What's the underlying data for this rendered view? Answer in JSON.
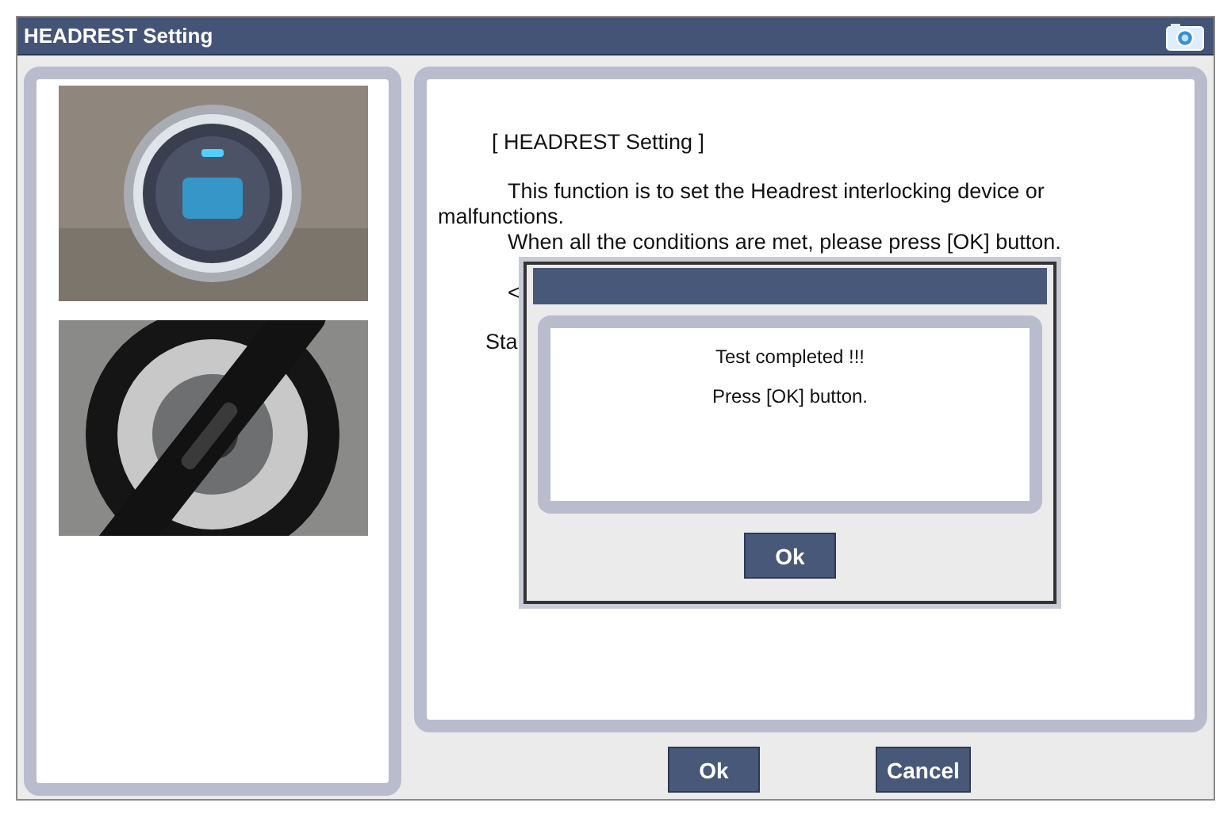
{
  "window": {
    "title": "HEADREST Setting"
  },
  "content": {
    "heading": "[ HEADREST Setting ]",
    "paragraphs": [
      "This function is to set the Headrest interlocking device or malfunctions.",
      "When all the conditions are met, please press [OK] button."
    ],
    "line_3": "<",
    "line_4": "Sta"
  },
  "dialog": {
    "messages": [
      "Test completed !!!",
      "Press [OK] button."
    ],
    "button": "Ok"
  },
  "buttons": [
    "Ok",
    "Cancel"
  ]
}
